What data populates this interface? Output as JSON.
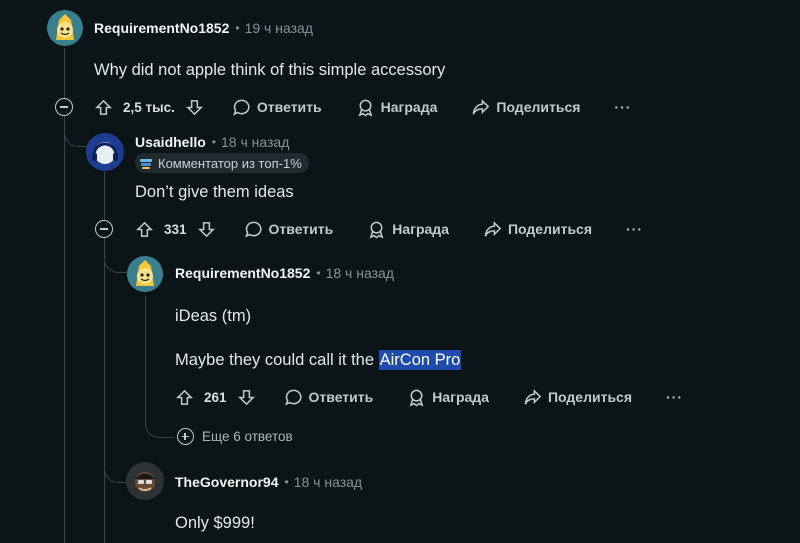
{
  "comments": [
    {
      "username": "RequirementNo1852",
      "time": "19 ч назад",
      "body": "Why did not apple think of this simple accessory",
      "votes": "2,5 тыс.",
      "actions": {
        "reply": "Ответить",
        "award": "Награда",
        "share": "Поделиться",
        "more": "···"
      }
    },
    {
      "username": "Usaidhello",
      "time": "18 ч назад",
      "badge": "Комментатор из топ-1%",
      "body": "Don’t give them ideas",
      "votes": "331",
      "actions": {
        "reply": "Ответить",
        "award": "Награда",
        "share": "Поделиться",
        "more": "···"
      }
    },
    {
      "username": "RequirementNo1852",
      "time": "18 ч назад",
      "body_line1": "iDeas (tm)",
      "body_line2_prefix": "Maybe they could call it the ",
      "body_line2_highlight": "AirCon Pro",
      "votes": "261",
      "actions": {
        "reply": "Ответить",
        "award": "Награда",
        "share": "Поделиться",
        "more": "···"
      }
    },
    {
      "username": "TheGovernor94",
      "time": "18 ч назад",
      "body": "Only $999!"
    }
  ],
  "more_replies": "Еще 6 ответов",
  "colors": {
    "background": "#0b1416",
    "highlight": "#1f4baf",
    "thread_line": "#33464c"
  }
}
